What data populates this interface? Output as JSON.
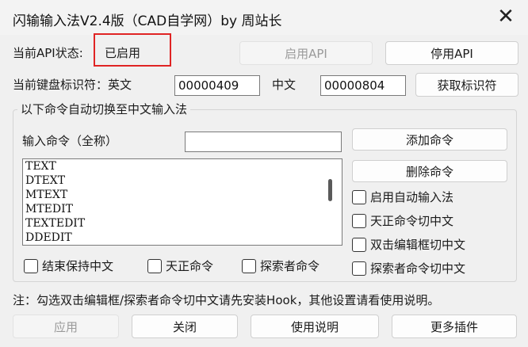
{
  "window": {
    "title": "闪输输入法V2.4版（CAD自学网）by 周站长",
    "close_glyph": "✕"
  },
  "api": {
    "status_label": "当前API状态:",
    "status_value": "已启用",
    "enable_btn": "启用API",
    "disable_btn": "停用API"
  },
  "keyboard": {
    "label": "当前键盘标识符：英文",
    "english_id": "00000409",
    "chinese_label": "中文",
    "chinese_id": "00000804",
    "fetch_btn": "获取标识符"
  },
  "group": {
    "title": "以下命令自动切换至中文输入法",
    "input_label": "输入命令（全称）",
    "input_value": "",
    "add_btn": "添加命令",
    "delete_btn": "删除命令",
    "commands": [
      "TEXT",
      "DTEXT",
      "MTEXT",
      "MTEDIT",
      "TEXTEDIT",
      "DDEDIT"
    ]
  },
  "options": {
    "auto_input": "启用自动输入法",
    "tzh_switch": "天正命令切中文",
    "dblclick_switch": "双击编辑框切中文",
    "explorer_switch": "探索者命令切中文",
    "keep_chinese": "结束保持中文",
    "tzh_cmd": "天正命令",
    "explorer_cmd": "探索者命令"
  },
  "note": "注：勾选双击编辑框/探索者命令切中文请先安装Hook，其他设置请看使用说明。",
  "footer": {
    "apply": "应用",
    "close": "关闭",
    "help": "使用说明",
    "more": "更多插件"
  }
}
